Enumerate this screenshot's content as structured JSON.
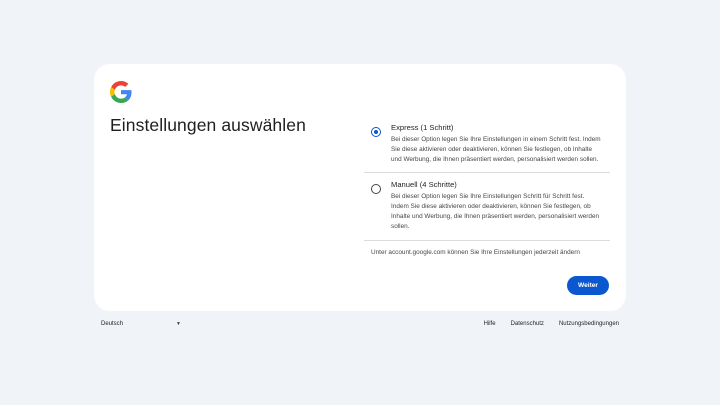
{
  "card": {
    "title": "Einstellungen auswählen"
  },
  "options": [
    {
      "title": "Express (1 Schritt)",
      "description_lines": [
        "Bei dieser Option legen Sie Ihre Einstellungen in einem Schritt fest. Indem",
        "Sie diese aktivieren oder deaktivieren, können Sie festlegen, ob Inhalte",
        "und Werbung, die Ihnen präsentiert werden, personalisiert werden sollen."
      ],
      "selected": true
    },
    {
      "title": "Manuell (4 Schritte)",
      "description_lines": [
        "Bei dieser Option legen Sie Ihre Einstellungen Schritt für Schritt fest.",
        "Indem Sie diese aktivieren oder deaktivieren, können Sie festlegen, ob",
        "Inhalte und Werbung, die Ihnen präsentiert werden, personalisiert werden",
        "sollen."
      ],
      "selected": false
    }
  ],
  "note": "Unter account.google.com können Sie Ihre Einstellungen jederzeit ändern",
  "next_button": "Weiter",
  "footer": {
    "language": "Deutsch",
    "links": [
      "Hilfe",
      "Datenschutz",
      "Nutzungsbedingungen"
    ]
  },
  "colors": {
    "background": "#f0f4f9",
    "accent": "#0b57d0",
    "google_blue": "#4285F4",
    "google_red": "#EA4335",
    "google_yellow": "#FBBC05",
    "google_green": "#34A853"
  }
}
